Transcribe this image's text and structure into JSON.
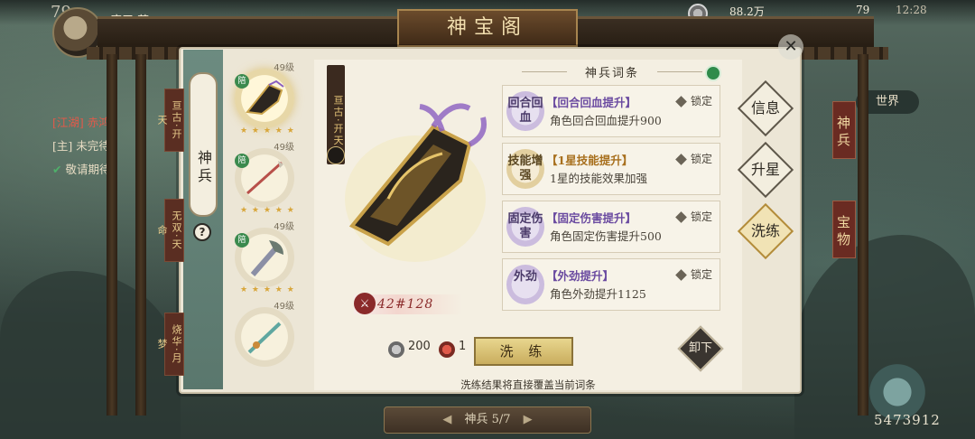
{
  "hud": {
    "level": "79",
    "player_name": "唐三·茗",
    "currency": "88.2万",
    "energy": "79",
    "time": "12:28",
    "world_label": "世界",
    "bottom_number": "5473912"
  },
  "chat": [
    {
      "tag": "[江湖]",
      "text": "赤鸿"
    },
    {
      "tag": "[主]",
      "text": "未完待"
    },
    {
      "tag": "✔",
      "text": "敬请期待"
    }
  ],
  "title": "神宝阁",
  "left_tab": {
    "label": "神兵",
    "help": "?"
  },
  "weapons": [
    {
      "level": "49级",
      "badge": "陪",
      "stars": "★ ★ ★ ★ ★",
      "name": "亘古·开天",
      "active": true
    },
    {
      "level": "49级",
      "badge": "陪",
      "stars": "★ ★ ★ ★ ★",
      "name": "无双·天命",
      "active": false
    },
    {
      "level": "49级",
      "badge": "陪",
      "stars": "★ ★ ★ ★ ★",
      "name": "",
      "active": false
    },
    {
      "level": "49级",
      "badge": "",
      "stars": "",
      "name": "烧华·月梦",
      "active": false
    }
  ],
  "selected_weapon": {
    "name": "亘古·开天",
    "power": "42#128"
  },
  "section_title": "神兵词条",
  "attributes": [
    {
      "icon_text": "回合回血",
      "title": "【回合回血提升】",
      "desc": "角色回合回血提升900",
      "lock": "锁定",
      "tier": "purple"
    },
    {
      "icon_text": "技能增强",
      "title": "【1星技能提升】",
      "desc": "1星的技能效果加强",
      "lock": "锁定",
      "tier": "gold"
    },
    {
      "icon_text": "固定伤害",
      "title": "【固定伤害提升】",
      "desc": "角色固定伤害提升500",
      "lock": "锁定",
      "tier": "purple"
    },
    {
      "icon_text": "外劲",
      "title": "【外劲提升】",
      "desc": "角色外劲提升1125",
      "lock": "锁定",
      "tier": "purple"
    }
  ],
  "cost": {
    "silver": "200",
    "item": "1"
  },
  "refine_button": "洗 练",
  "notice": "洗练结果将直接覆盖当前词条",
  "unequip": "卸下",
  "right_nav": [
    {
      "label": "信息"
    },
    {
      "label": "升星"
    },
    {
      "label": "洗练"
    }
  ],
  "right_tabs": [
    {
      "label": "神兵"
    },
    {
      "label": "宝物"
    }
  ],
  "footer": {
    "prev": "◀",
    "label": "神兵 5/7",
    "next": "▶"
  },
  "colors": {
    "panel_bg": "#ece6d6",
    "accent_gold": "#c9ad5e",
    "purple_attr": "#6a4aa0",
    "gold_attr": "#a8701e",
    "tab_red": "#6a2b22"
  }
}
